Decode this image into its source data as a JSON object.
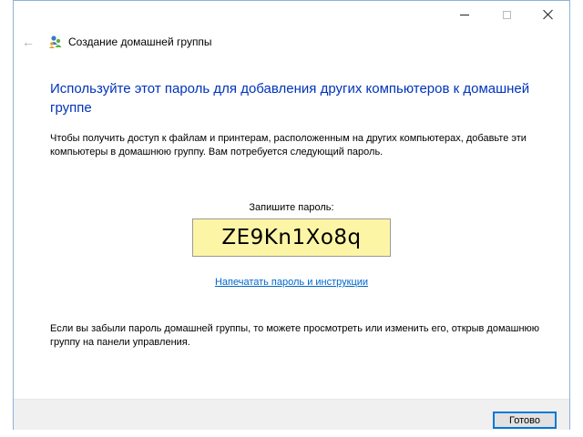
{
  "window": {
    "controls": {
      "minimize_icon": "minimize-icon",
      "maximize_icon": "maximize-icon",
      "close_icon": "close-icon"
    }
  },
  "nav": {
    "back_icon": "back-arrow-icon",
    "app_icon": "homegroup-icon",
    "title": "Создание домашней группы"
  },
  "content": {
    "heading": "Используйте этот пароль для добавления других компьютеров к домашней группе",
    "description": "Чтобы получить доступ к файлам и принтерам, расположенным на других компьютерах, добавьте эти компьютеры в домашнюю группу. Вам потребуется следующий пароль.",
    "password_label": "Запишите пароль:",
    "password_value": "ZE9Kn1Xo8q",
    "print_link": "Напечатать пароль и инструкции",
    "footer_text": "Если вы забыли пароль домашней группы, то можете просмотреть или изменить его, открыв домашнюю группу на панели управления."
  },
  "buttons": {
    "done": "Готово"
  },
  "colors": {
    "heading": "#0033bb",
    "link": "#0066cc",
    "password_bg": "#fdf5a6",
    "accent": "#0078d7"
  }
}
